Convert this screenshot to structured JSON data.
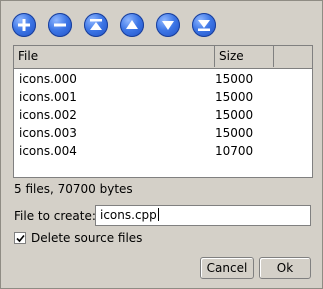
{
  "toolbar": {
    "buttons": [
      {
        "icon": "plus-icon"
      },
      {
        "icon": "minus-icon"
      },
      {
        "icon": "move-top-icon"
      },
      {
        "icon": "move-up-icon"
      },
      {
        "icon": "move-down-icon"
      },
      {
        "icon": "move-bottom-icon"
      }
    ],
    "color": "#2f66dc"
  },
  "list": {
    "columns": [
      "File",
      "Size"
    ],
    "rows": [
      {
        "file": "icons.000",
        "size": "15000"
      },
      {
        "file": "icons.001",
        "size": "15000"
      },
      {
        "file": "icons.002",
        "size": "15000"
      },
      {
        "file": "icons.003",
        "size": "15000"
      },
      {
        "file": "icons.004",
        "size": "10700"
      }
    ]
  },
  "summary": "5 files, 70700 bytes",
  "create": {
    "label": "File to create:",
    "value": "icons.cpp"
  },
  "delete_source": {
    "label": "Delete source files",
    "checked": true
  },
  "buttons": {
    "cancel": "Cancel",
    "ok": "Ok"
  }
}
